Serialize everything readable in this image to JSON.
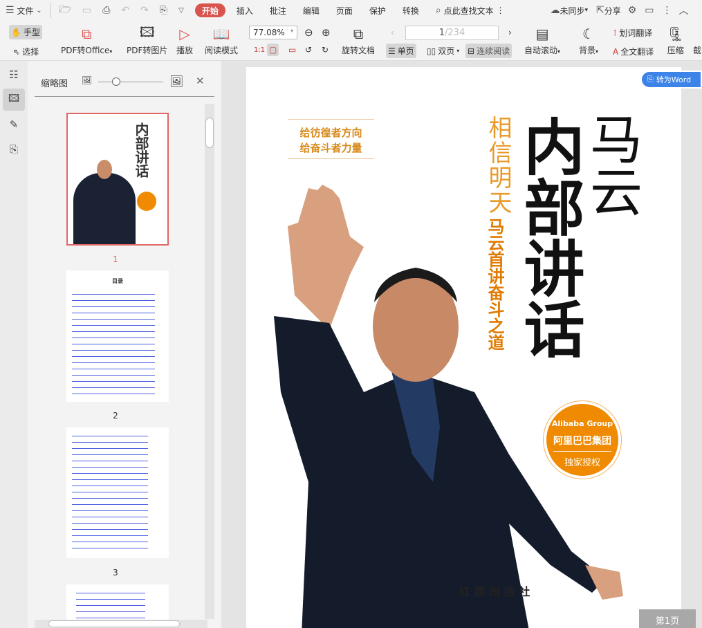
{
  "menubar": {
    "file": "文件",
    "tabs": [
      "开始",
      "插入",
      "批注",
      "编辑",
      "页面",
      "保护",
      "转换"
    ],
    "search": "点此查找文本",
    "sync": "未同步",
    "share": "分享"
  },
  "toolbar": {
    "hand": "手型",
    "select": "选择",
    "pdf_office": "PDF转Office",
    "pdf_image": "PDF转图片",
    "play": "播放",
    "read_mode": "阅读模式",
    "zoom": "77.08%",
    "rotate": "旋转文档",
    "page_current": "1",
    "page_total": "/234",
    "single": "单页",
    "double": "双页",
    "continuous": "连续阅读",
    "auto_scroll": "自动滚动",
    "background": "背景",
    "word_translate": "划词翻译",
    "full_translate": "全文翻译",
    "compress": "压缩",
    "crop": "截"
  },
  "panel": {
    "title": "缩略图",
    "thumbs": [
      {
        "label": "1"
      },
      {
        "label": "2",
        "heading": "目录"
      },
      {
        "label": "3"
      }
    ],
    "zoom_slider": 0.3
  },
  "document": {
    "convert_word": "转为Word",
    "page_indicator": "第1页",
    "cover": {
      "slogan1": "给彷徨者方向",
      "slogan2": "给奋斗者力量",
      "subtitle": "相信明天",
      "author": "马云",
      "title": "内部讲话",
      "tagline": "马云首讲奋斗之道",
      "logo_en": "Alibaba Group",
      "logo_cn": "阿里巴巴集团",
      "license": "独家授权",
      "publisher": "红 旗 出 版 社"
    }
  }
}
